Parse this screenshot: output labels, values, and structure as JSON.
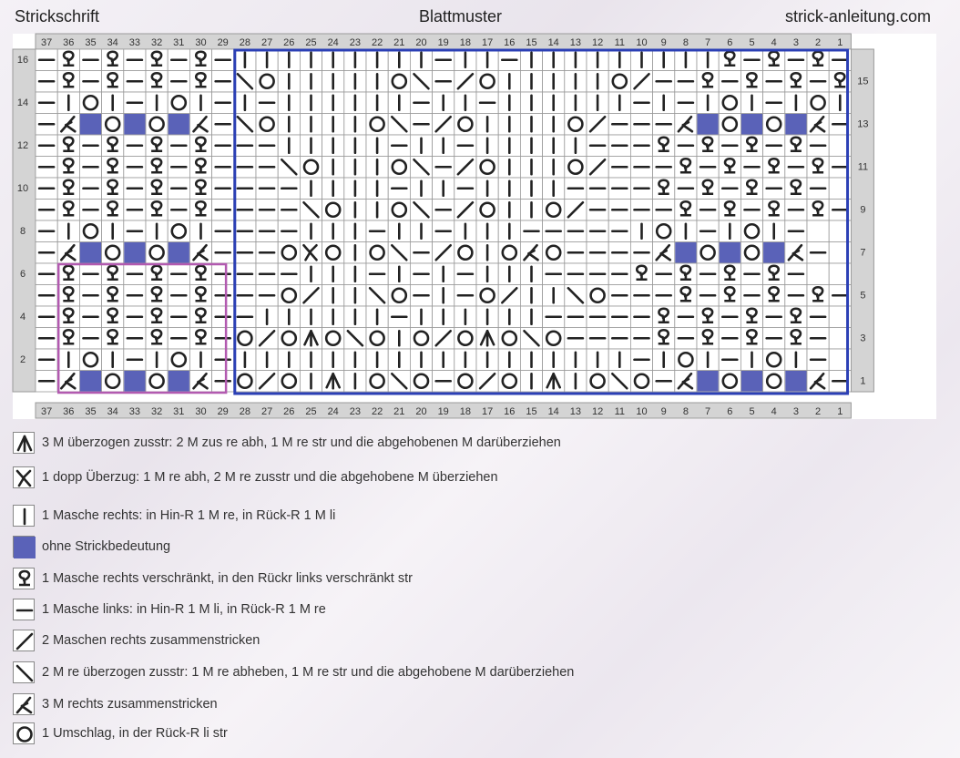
{
  "header": {
    "left": "Strickschrift",
    "center": "Blattmuster",
    "right": "strick-anleitung.com"
  },
  "chart": {
    "columns": 37,
    "rows": 16,
    "column_numbers": [
      "37",
      "36",
      "35",
      "34",
      "33",
      "32",
      "31",
      "30",
      "29",
      "28",
      "27",
      "26",
      "25",
      "24",
      "23",
      "22",
      "21",
      "20",
      "19",
      "18",
      "17",
      "16",
      "15",
      "14",
      "13",
      "12",
      "11",
      "10",
      "9",
      "8",
      "7",
      "6",
      "5",
      "4",
      "3",
      "2",
      "1"
    ],
    "left_row_numbers": [
      "16",
      "14",
      "12",
      "10",
      "8",
      "6",
      "4",
      "2"
    ],
    "right_row_numbers": [
      "15",
      "13",
      "11",
      "9",
      "7",
      "5",
      "3",
      "1"
    ],
    "colors": {
      "blue_frame": "#2b3fb5",
      "pink_frame": "#b25ab0",
      "no_stitch": "#5a62b8",
      "grid": "#9a9a9a",
      "symbol": "#222222"
    },
    "grid": [
      "-T-T-T-T-|||||||||-||-|||||||||T-T-T-T-",
      "-T-T-T-T-\\O|||||O\\-/O|||||O/--T-T-T-T-",
      "-|O|-|O|-|-||||||-||-||||||-|-|O|-|O|-",
      "-KXOXOX<-\\O||||O\\-/O||||O/---KXOXOXK-",
      "-T-T-T-T---|||||-||-|||||---T-T-T-T-",
      "-T-T-T-T---\\O|||O\\-/O|||O/---T-T-T-T-",
      "-T-T-T-T----||||-||-||||----T-T-T-T-",
      "-T-T-T-T----\\O||O\\-/O||O/----T-T-T-T-",
      "-|O|-|O|----|||-||-|||-----|O|-|O|-",
      "-KXOXOXK---OHO|O\\-/O|OKO----KXOXOXK-",
      "-T-T-T-T----|||-|-|-|||----T-T-T-T-",
      "-T-T-T-T---O/||\\O-|-O/||\\O---T-T-T-T-",
      "-T-T-T-T--||||||-||||||-----T-T-T-T-",
      "-T-T-T-T-O/OAO\\O|O/OAO\\O----T-T-T-T-",
      "-|O|-|O|-||||||||||||||||||-|O|-|O|-",
      "-KXOXOXK-O/O|A|O\\O-O/O|A|O\\O-KXOXOXK-"
    ]
  },
  "legend": [
    {
      "icon": "sk3-icon",
      "text": "3 M überzogen zusstr: 2 M zus re abh, 1 M re str und die abgehobenen M darüberziehen"
    },
    {
      "icon": "dopp-ueberzug-icon",
      "text": "1 dopp Überzug: 1 M re abh, 2 M re zusstr und die abgehobene M überziehen"
    },
    {
      "icon": "knit-icon",
      "text": "1 Masche rechts: in Hin-R 1 M re, in Rück-R 1 M li"
    },
    {
      "icon": "no-stitch-icon",
      "text": "ohne Strickbedeutung"
    },
    {
      "icon": "twisted-knit-icon",
      "text": "1 Masche rechts verschränkt, in den Rückr links verschränkt str"
    },
    {
      "icon": "purl-icon",
      "text": "1 Masche links: in Hin-R 1 M li, in Rück-R 1 M re"
    },
    {
      "icon": "k2tog-icon",
      "text": "2 Maschen rechts zusammenstricken"
    },
    {
      "icon": "ssk-icon",
      "text": "2 M re überzogen zusstr: 1 M re abheben, 1 M re str und die abgehobene M darüberziehen"
    },
    {
      "icon": "k3tog-icon",
      "text": "3 M rechts zusammenstricken"
    },
    {
      "icon": "yarn-over-icon",
      "text": "1 Umschlag, in der Rück-R li str"
    }
  ]
}
